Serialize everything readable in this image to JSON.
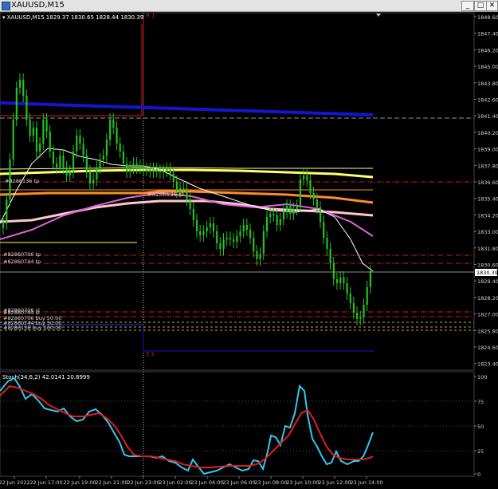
{
  "window": {
    "title": "XAUUSD,M15",
    "min_glyph": "_",
    "max_glyph": "□",
    "close_glyph": "✕"
  },
  "chart": {
    "info": "▾ XAUUSD,M15  1829.37 1830.65 1828.44 1830.39",
    "price_ticks": [
      "1848.60",
      "1847.40",
      "1846.20",
      "1845.00",
      "1843.80",
      "1842.60",
      "1841.40",
      "1840.20",
      "1839.00",
      "1837.80",
      "1836.60",
      "1835.40",
      "1834.20",
      "1833.00",
      "1831.80",
      "1830.60",
      "1829.40",
      "1828.20",
      "1827.00",
      "1825.80",
      "1824.60",
      "1823.40"
    ],
    "current_price": "1830.39",
    "order_labels": [
      "#8286136 tp",
      "#82860706 tp",
      "#82860744 tp",
      "#82860706 sl",
      "#82860744 sl",
      "#82860706 buy 50.00",
      "#82860744 buy 50.00",
      "#8286136 buy 100.00"
    ],
    "r_label": "R 1",
    "s_label": "S 1",
    "ma_text_label": "#8286136 sl"
  },
  "stoch": {
    "info": "Stoch(34,6,2) 42.0141 20.8999",
    "levels": [
      "100",
      "75",
      "50",
      "25",
      "0"
    ]
  },
  "time_labels": [
    "22 Jun 2022",
    "22 Jun 17:00",
    "22 Jun 19:00",
    "22 Jun 21:00",
    "22 Jun 23:00",
    "23 Jun 02:00",
    "23 Jun 04:00",
    "23 Jun 06:00",
    "23 Jun 08:00",
    "23 Jun 10:00",
    "23 Jun 12:00",
    "23 Jun 14:00"
  ],
  "colors": {
    "up": "#22c322",
    "blue_line": "#1414d2",
    "yellow_ma": "#ffff66",
    "orange_ma": "#ff8c28",
    "magenta_ma": "#dc64dc",
    "white_ma": "#ffffff",
    "pink_ma": "#ffb4b4",
    "red_level": "#c81e1e",
    "stoch_main": "#32c8f0",
    "stoch_signal": "#e01e1e"
  }
}
